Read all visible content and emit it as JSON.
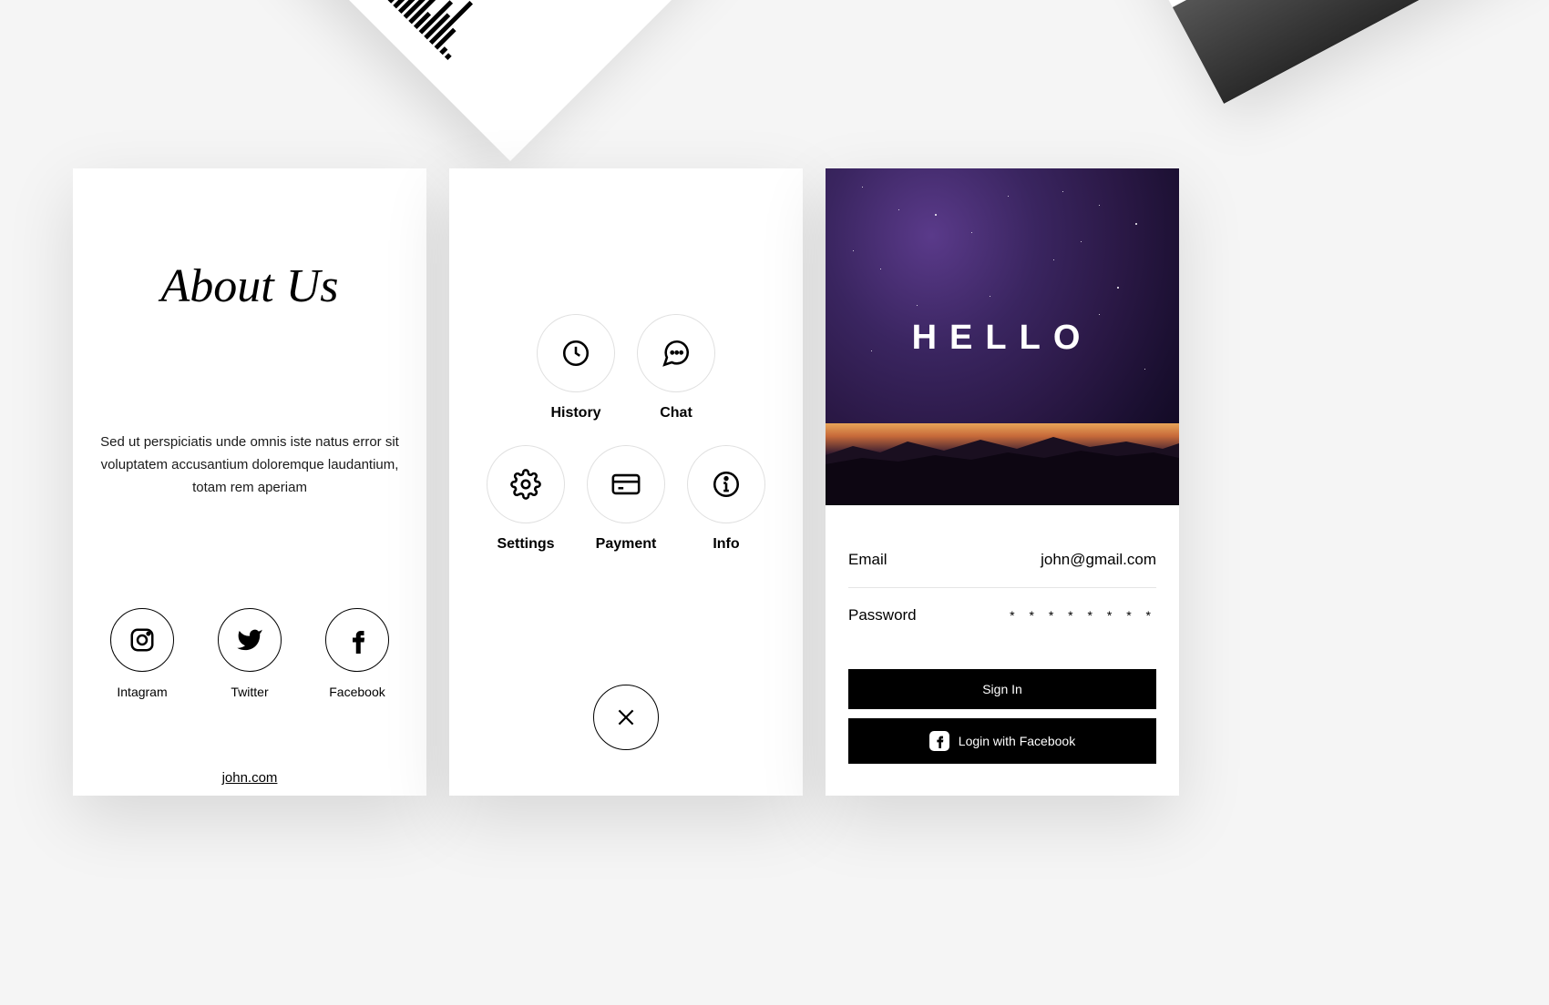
{
  "decor_chart": {
    "ticks": [
      "10",
      "20",
      "30"
    ]
  },
  "about": {
    "title": "About Us",
    "body": "Sed ut perspiciatis unde omnis iste natus error sit voluptatem accusantium doloremque laudantium, totam rem aperiam",
    "socials": [
      {
        "icon": "instagram-icon",
        "label": "Intagram"
      },
      {
        "icon": "twitter-icon",
        "label": "Twitter"
      },
      {
        "icon": "facebook-icon",
        "label": "Facebook"
      }
    ],
    "website": "john.com"
  },
  "menu": {
    "items_row1": [
      {
        "icon": "clock-icon",
        "label": "History"
      },
      {
        "icon": "chat-icon",
        "label": "Chat"
      }
    ],
    "items_row2": [
      {
        "icon": "gear-icon",
        "label": "Settings"
      },
      {
        "icon": "card-icon",
        "label": "Payment"
      },
      {
        "icon": "info-icon",
        "label": "Info"
      }
    ]
  },
  "login": {
    "hero_text": "HELLO",
    "email_label": "Email",
    "email_value": "john@gmail.com",
    "password_label": "Password",
    "password_value": "* * * * * * * *",
    "signin_label": "Sign In",
    "facebook_label": "Login with Facebook"
  }
}
